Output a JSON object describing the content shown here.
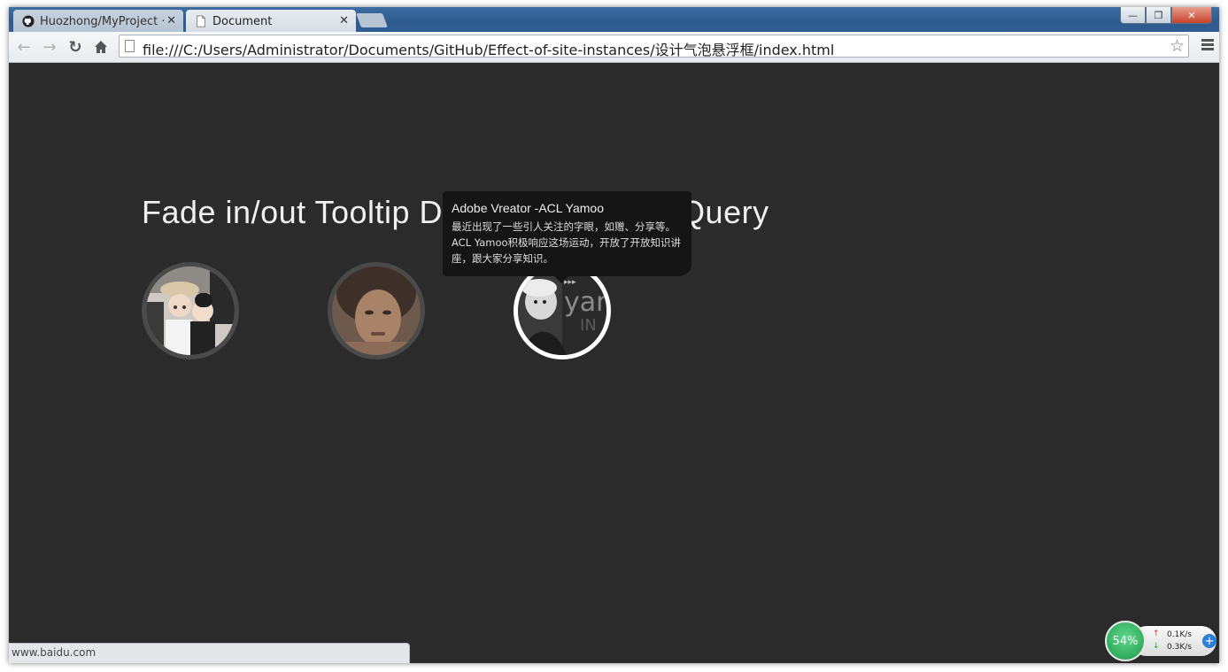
{
  "browser": {
    "tabs": [
      {
        "label": "Huozhong/MyProject · ",
        "icon": "github-icon",
        "active": false
      },
      {
        "label": "Document",
        "icon": "page-icon",
        "active": true
      }
    ],
    "address": "file:///C:/Users/Administrator/Documents/GitHub/Effect-of-site-instances/设计气泡悬浮框/index.html",
    "status_url": "www.baidu.com",
    "window_controls": {
      "minimize": "—",
      "restore": "❐",
      "close": "✕"
    }
  },
  "page": {
    "heading_left": "Fade in/out Tooltip D",
    "heading_right": "Query",
    "avatars": [
      {
        "name": "Photo of two girls",
        "active": false
      },
      {
        "name": "Portrait photo",
        "active": false
      },
      {
        "name": "Yamoo portrait",
        "active": true
      }
    ],
    "tooltip": {
      "title": "Adobe Vreator -ACL Yamoo",
      "body": "最近出现了一些引人关注的字眼，如赠、分享等。ACL Yamoo积极响应这场运动，开放了开放知识讲座，跟大家分享知识。"
    }
  },
  "widget": {
    "percent": "54%",
    "upload": "0.1K/s",
    "download": "0.3K/s",
    "accent": "#1e9a4c"
  }
}
